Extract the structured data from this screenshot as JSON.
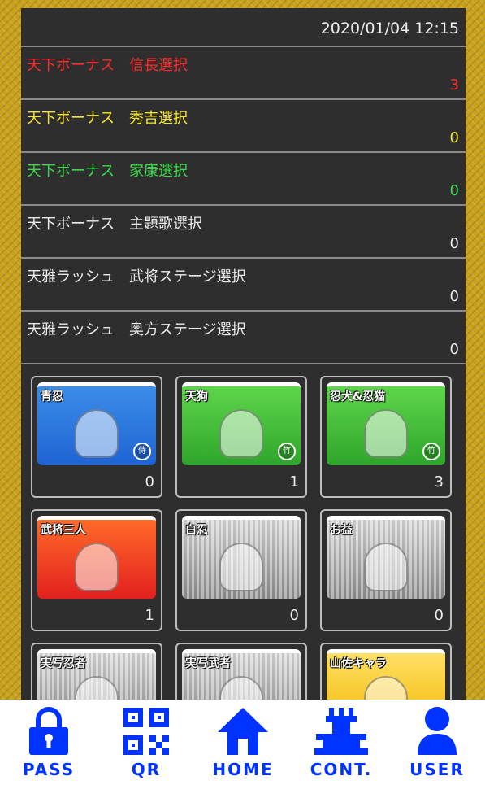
{
  "datetime": "2020/01/04 12:15",
  "rows": [
    {
      "label": "天下ボーナス　信長選択",
      "count": "3",
      "color": "#ff2a2a"
    },
    {
      "label": "天下ボーナス　秀吉選択",
      "count": "0",
      "color": "#f5e52e"
    },
    {
      "label": "天下ボーナス　家康選択",
      "count": "0",
      "color": "#3cd94a"
    },
    {
      "label": "天下ボーナス　主題歌選択",
      "count": "0",
      "color": "#ececec"
    },
    {
      "label": "天雅ラッシュ　武将ステージ選択",
      "count": "0",
      "color": "#ececec"
    },
    {
      "label": "天雅ラッシュ　奥方ステージ選択",
      "count": "0",
      "color": "#ececec"
    }
  ],
  "cards": [
    {
      "name": "青忍",
      "count": "0",
      "badge": "侍",
      "theme": "blue"
    },
    {
      "name": "天狗",
      "count": "1",
      "badge": "竹",
      "theme": "green"
    },
    {
      "name": "忍犬&忍猫",
      "count": "3",
      "badge": "竹",
      "theme": "green"
    },
    {
      "name": "武将三人",
      "count": "1",
      "badge": "",
      "theme": "red"
    },
    {
      "name": "白忍",
      "count": "0",
      "badge": "",
      "theme": "silver"
    },
    {
      "name": "お益",
      "count": "0",
      "badge": "",
      "theme": "silver"
    },
    {
      "name": "実写忍者",
      "count": "",
      "badge": "",
      "theme": "silver"
    },
    {
      "name": "実写武者",
      "count": "",
      "badge": "",
      "theme": "silver"
    },
    {
      "name": "山佐キャラ",
      "count": "",
      "badge": "",
      "theme": "gold"
    }
  ],
  "nav": {
    "pass": "PASS",
    "qr": "QR",
    "home": "HOME",
    "cont": "CONT.",
    "user": "USER"
  },
  "icons": {
    "pass": "lock-icon",
    "qr": "qr-code-icon",
    "home": "home-icon",
    "cont": "castle-icon",
    "user": "user-icon"
  },
  "colors": {
    "nav_accent": "#0033ff",
    "panel_bg": "#2e2e2e",
    "border_gold": "#c9a21c"
  }
}
